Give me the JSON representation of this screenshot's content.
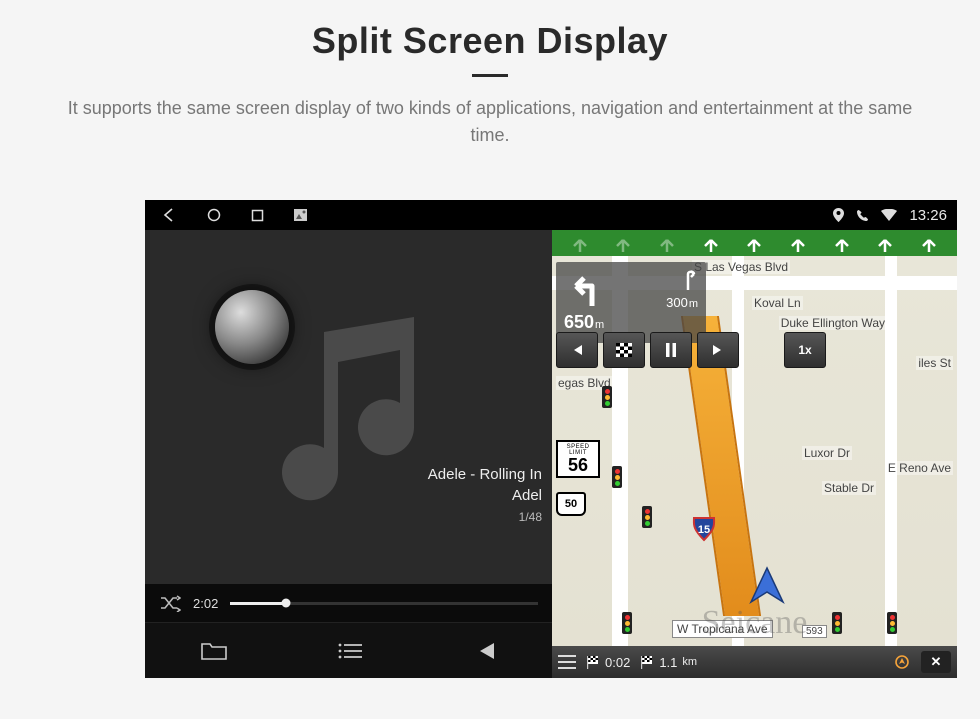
{
  "header": {
    "title": "Split Screen Display",
    "subtitle": "It supports the same screen display of two kinds of applications, navigation and entertainment at the same time."
  },
  "status": {
    "time": "13:26"
  },
  "music": {
    "track_title": "Adele - Rolling In",
    "track_artist": "Adel",
    "track_count": "1/48",
    "elapsed": "2:02"
  },
  "nav": {
    "turn": {
      "main_distance_value": "650",
      "main_distance_unit": "m",
      "next_distance_value": "300",
      "next_distance_unit": "m"
    },
    "playback_speed": "1x",
    "speed_limit_label": "SPEED LIMIT",
    "speed_limit_value": "56",
    "route_shield": "50",
    "interstate": "15",
    "eta_time": "0:02",
    "remaining_value": "1.1",
    "remaining_unit": "km",
    "roads": {
      "top": "S Las Vegas Blvd",
      "bottom": "W Tropicana Ave",
      "bottom_num": "593",
      "r1": "Duke Ellington Way",
      "r2": "Koval Ln",
      "r3": "E Reno Ave",
      "r4": "Luxor Dr",
      "r5": "Stable Dr",
      "r6": "egas Blvd",
      "r7": "iles St"
    },
    "close": "✕"
  },
  "watermark": "Seicane"
}
